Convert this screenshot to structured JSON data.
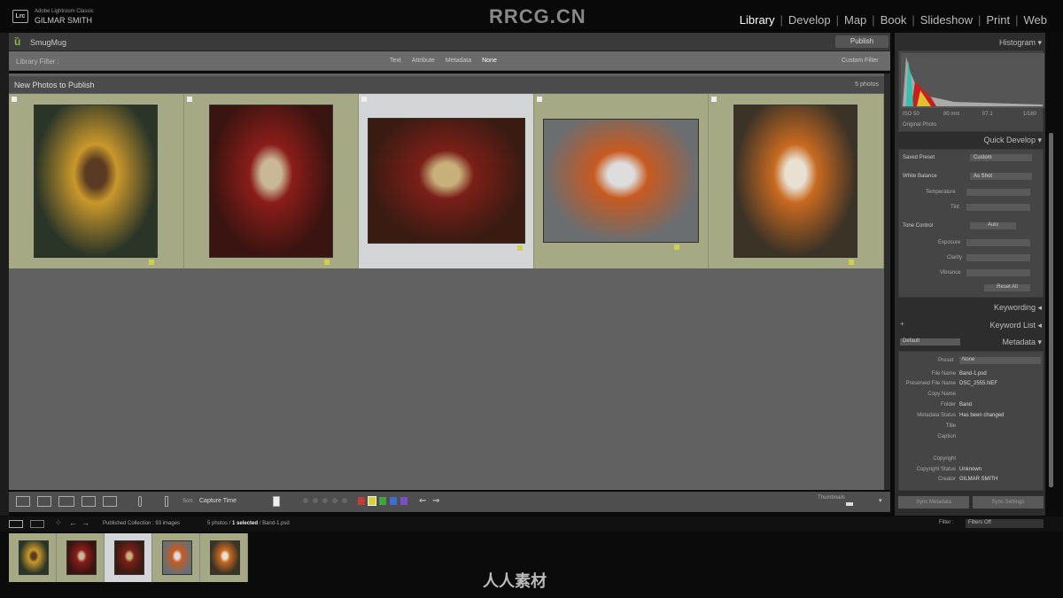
{
  "app": {
    "product": "Adobe Lightroom Classic",
    "user": "GILMAR SMITH",
    "logo": "Lrc"
  },
  "watermark": "RRCG.CN",
  "modules": [
    {
      "label": "Library",
      "active": true
    },
    {
      "label": "Develop"
    },
    {
      "label": "Map"
    },
    {
      "label": "Book"
    },
    {
      "label": "Slideshow"
    },
    {
      "label": "Print"
    },
    {
      "label": "Web"
    }
  ],
  "service": {
    "name": "SmugMug",
    "publish_label": "Publish"
  },
  "library_filter": {
    "label": "Library Filter :",
    "options": [
      "Text",
      "Attribute",
      "Metadata",
      "None"
    ],
    "active": "None",
    "lock": "Custom Filter"
  },
  "grid": {
    "title": "New Photos to Publish",
    "count": "5 photos",
    "photos": [
      {
        "name": "girl-yellow-pumpkin",
        "selected": false,
        "colors": [
          "#2a3528",
          "#c9982a",
          "#5a3a22"
        ]
      },
      {
        "name": "girl-red-horn",
        "selected": false,
        "colors": [
          "#3a1410",
          "#8a1d1a",
          "#c9b895"
        ]
      },
      {
        "name": "band-hat-girl",
        "selected": true,
        "colors": [
          "#3a1b12",
          "#7a1f18",
          "#c8b07a"
        ]
      },
      {
        "name": "girl-pumpkin-field",
        "selected": false,
        "colors": [
          "#6b6e70",
          "#c75a20",
          "#ddd"
        ]
      },
      {
        "name": "girl-flowers",
        "selected": false,
        "colors": [
          "#3b3326",
          "#c86a20",
          "#e8e0d0"
        ]
      }
    ]
  },
  "toolbar": {
    "sort_label": "Sort:",
    "sort_value": "Capture Time",
    "thumbnails_label": "Thumbnails",
    "label_colors": [
      "#c23b3b",
      "#d8d23a",
      "#3fa33f",
      "#3a6fd0",
      "#7a4fc0"
    ]
  },
  "right_panel": {
    "histogram": {
      "title": "Histogram",
      "readout": [
        "ISO 50",
        "80 mm",
        "f/7.1",
        "1/160"
      ],
      "original_photo": "Original Photo"
    },
    "quick_develop": {
      "title": "Quick Develop",
      "saved_preset_label": "Saved Preset",
      "saved_preset_value": "Custom",
      "white_balance_label": "White Balance",
      "white_balance_value": "As Shot",
      "temperature": "Temperature",
      "tint": "Tint",
      "tone_control": "Tone Control",
      "auto": "Auto",
      "exposure": "Exposure",
      "clarity": "Clarity",
      "vibrance": "Vibrance",
      "reset": "Reset All"
    },
    "keywording": "Keywording",
    "keyword_list": "Keyword List",
    "metadata": {
      "title": "Metadata",
      "preset": "Default",
      "preset_label": "Preset",
      "preset_value": "None",
      "fields": [
        {
          "label": "File Name",
          "value": "Band-1.psd"
        },
        {
          "label": "Preserved File Name",
          "value": "DSC_2555.NEF"
        },
        {
          "label": "Copy Name",
          "value": ""
        },
        {
          "label": "Folder",
          "value": "Band"
        },
        {
          "label": "Metadata Status",
          "value": "Has been changed"
        },
        {
          "label": "Title",
          "value": ""
        },
        {
          "label": "Caption",
          "value": ""
        },
        {
          "label": "Copyright",
          "value": ""
        },
        {
          "label": "Copyright Status",
          "value": "Unknown"
        },
        {
          "label": "Creator",
          "value": "GILMAR SMITH"
        }
      ]
    },
    "buttons": [
      "Sync Metadata",
      "Sync Settings"
    ]
  },
  "filmstrip": {
    "path": "Published Collection : 93 images",
    "selection_prefix": "5 photos /",
    "selection_bold": "1 selected",
    "selection_suffix": "/ Band-1.psd",
    "filter_label": "Filter :",
    "filter_value": "Filters Off"
  },
  "bottom_watermark": "人人素材"
}
